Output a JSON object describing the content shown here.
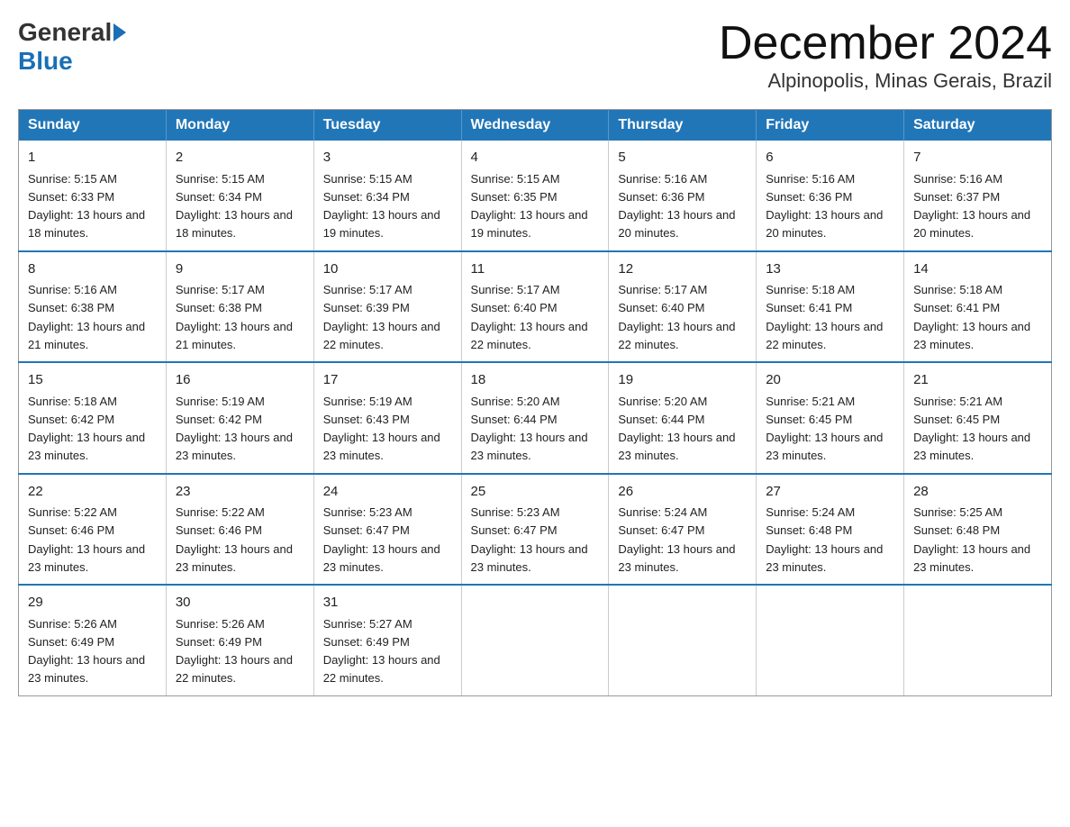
{
  "logo": {
    "general": "General",
    "blue": "Blue"
  },
  "header": {
    "month": "December 2024",
    "location": "Alpinopolis, Minas Gerais, Brazil"
  },
  "days_of_week": [
    "Sunday",
    "Monday",
    "Tuesday",
    "Wednesday",
    "Thursday",
    "Friday",
    "Saturday"
  ],
  "weeks": [
    [
      {
        "day": "1",
        "sunrise": "5:15 AM",
        "sunset": "6:33 PM",
        "daylight": "13 hours and 18 minutes."
      },
      {
        "day": "2",
        "sunrise": "5:15 AM",
        "sunset": "6:34 PM",
        "daylight": "13 hours and 18 minutes."
      },
      {
        "day": "3",
        "sunrise": "5:15 AM",
        "sunset": "6:34 PM",
        "daylight": "13 hours and 19 minutes."
      },
      {
        "day": "4",
        "sunrise": "5:15 AM",
        "sunset": "6:35 PM",
        "daylight": "13 hours and 19 minutes."
      },
      {
        "day": "5",
        "sunrise": "5:16 AM",
        "sunset": "6:36 PM",
        "daylight": "13 hours and 20 minutes."
      },
      {
        "day": "6",
        "sunrise": "5:16 AM",
        "sunset": "6:36 PM",
        "daylight": "13 hours and 20 minutes."
      },
      {
        "day": "7",
        "sunrise": "5:16 AM",
        "sunset": "6:37 PM",
        "daylight": "13 hours and 20 minutes."
      }
    ],
    [
      {
        "day": "8",
        "sunrise": "5:16 AM",
        "sunset": "6:38 PM",
        "daylight": "13 hours and 21 minutes."
      },
      {
        "day": "9",
        "sunrise": "5:17 AM",
        "sunset": "6:38 PM",
        "daylight": "13 hours and 21 minutes."
      },
      {
        "day": "10",
        "sunrise": "5:17 AM",
        "sunset": "6:39 PM",
        "daylight": "13 hours and 22 minutes."
      },
      {
        "day": "11",
        "sunrise": "5:17 AM",
        "sunset": "6:40 PM",
        "daylight": "13 hours and 22 minutes."
      },
      {
        "day": "12",
        "sunrise": "5:17 AM",
        "sunset": "6:40 PM",
        "daylight": "13 hours and 22 minutes."
      },
      {
        "day": "13",
        "sunrise": "5:18 AM",
        "sunset": "6:41 PM",
        "daylight": "13 hours and 22 minutes."
      },
      {
        "day": "14",
        "sunrise": "5:18 AM",
        "sunset": "6:41 PM",
        "daylight": "13 hours and 23 minutes."
      }
    ],
    [
      {
        "day": "15",
        "sunrise": "5:18 AM",
        "sunset": "6:42 PM",
        "daylight": "13 hours and 23 minutes."
      },
      {
        "day": "16",
        "sunrise": "5:19 AM",
        "sunset": "6:42 PM",
        "daylight": "13 hours and 23 minutes."
      },
      {
        "day": "17",
        "sunrise": "5:19 AM",
        "sunset": "6:43 PM",
        "daylight": "13 hours and 23 minutes."
      },
      {
        "day": "18",
        "sunrise": "5:20 AM",
        "sunset": "6:44 PM",
        "daylight": "13 hours and 23 minutes."
      },
      {
        "day": "19",
        "sunrise": "5:20 AM",
        "sunset": "6:44 PM",
        "daylight": "13 hours and 23 minutes."
      },
      {
        "day": "20",
        "sunrise": "5:21 AM",
        "sunset": "6:45 PM",
        "daylight": "13 hours and 23 minutes."
      },
      {
        "day": "21",
        "sunrise": "5:21 AM",
        "sunset": "6:45 PM",
        "daylight": "13 hours and 23 minutes."
      }
    ],
    [
      {
        "day": "22",
        "sunrise": "5:22 AM",
        "sunset": "6:46 PM",
        "daylight": "13 hours and 23 minutes."
      },
      {
        "day": "23",
        "sunrise": "5:22 AM",
        "sunset": "6:46 PM",
        "daylight": "13 hours and 23 minutes."
      },
      {
        "day": "24",
        "sunrise": "5:23 AM",
        "sunset": "6:47 PM",
        "daylight": "13 hours and 23 minutes."
      },
      {
        "day": "25",
        "sunrise": "5:23 AM",
        "sunset": "6:47 PM",
        "daylight": "13 hours and 23 minutes."
      },
      {
        "day": "26",
        "sunrise": "5:24 AM",
        "sunset": "6:47 PM",
        "daylight": "13 hours and 23 minutes."
      },
      {
        "day": "27",
        "sunrise": "5:24 AM",
        "sunset": "6:48 PM",
        "daylight": "13 hours and 23 minutes."
      },
      {
        "day": "28",
        "sunrise": "5:25 AM",
        "sunset": "6:48 PM",
        "daylight": "13 hours and 23 minutes."
      }
    ],
    [
      {
        "day": "29",
        "sunrise": "5:26 AM",
        "sunset": "6:49 PM",
        "daylight": "13 hours and 23 minutes."
      },
      {
        "day": "30",
        "sunrise": "5:26 AM",
        "sunset": "6:49 PM",
        "daylight": "13 hours and 22 minutes."
      },
      {
        "day": "31",
        "sunrise": "5:27 AM",
        "sunset": "6:49 PM",
        "daylight": "13 hours and 22 minutes."
      },
      null,
      null,
      null,
      null
    ]
  ]
}
